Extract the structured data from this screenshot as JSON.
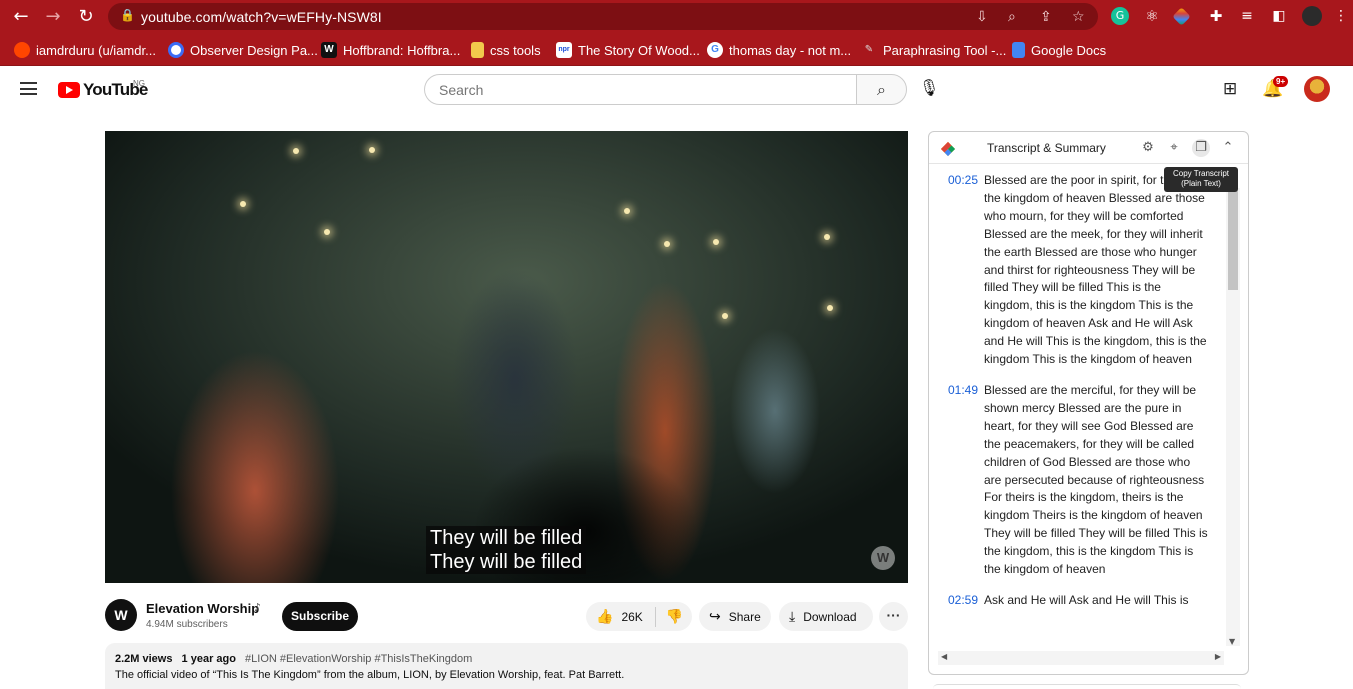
{
  "browser": {
    "url": "youtube.com/watch?v=wEFHy-NSW8I",
    "bookmarks": [
      {
        "label": "iamdrduru (u/iamdr...",
        "icon": "reddit-icon",
        "color": "#ff4500"
      },
      {
        "label": "Observer Design Pa...",
        "icon": "observer-icon",
        "color": "#3b6cf6"
      },
      {
        "label": "Hoffbrand: Hoffbra...",
        "icon": "w-icon",
        "color": "#111111"
      },
      {
        "label": "css tools",
        "icon": "folder-icon",
        "color": "#f2c94c"
      },
      {
        "label": "The Story Of Wood...",
        "icon": "npr-icon",
        "color": "#1d4ed8"
      },
      {
        "label": "thomas day - not m...",
        "icon": "google-icon",
        "color": "#ffffff"
      },
      {
        "label": "Paraphrasing Tool -...",
        "icon": "quill-icon",
        "color": "#9aa7b2"
      },
      {
        "label": "Google Docs",
        "icon": "docs-icon",
        "color": "#4285f4"
      }
    ]
  },
  "header": {
    "logo_text": "YouTube",
    "country": "NG",
    "search_placeholder": "Search",
    "notification_count": "9+"
  },
  "video": {
    "caption_line1": "They will be filled",
    "caption_line2": "They will be filled"
  },
  "channel": {
    "name": "Elevation Worship",
    "note_icon": "music-note-icon",
    "subscribers": "4.94M subscribers",
    "subscribe_label": "Subscribe",
    "likes": "26K",
    "share_label": "Share",
    "download_label": "Download"
  },
  "description": {
    "views": "2.2M views",
    "age": "1 year ago",
    "tags": "#LION #ElevationWorship #ThisIsTheKingdom",
    "text": "The official video of “This Is The Kingdom” from the album, LION, by Elevation Worship, feat. Pat Barrett."
  },
  "transcript": {
    "title": "Transcript & Summary",
    "tooltip_line1": "Copy Transcript",
    "tooltip_line2": "(Plain Text)",
    "entries": [
      {
        "time": "00:25",
        "text": "Blessed are the poor in spirit, for theirs is the kingdom of heaven Blessed are those who mourn, for they will be comforted Blessed are the meek, for they will inherit the earth Blessed are those who hunger and thirst for righteousness They will be filled They will be filled This is the kingdom, this is the kingdom This is the kingdom of heaven Ask and He will Ask and He will This is the kingdom, this is the kingdom This is the kingdom of heaven"
      },
      {
        "time": "01:49",
        "text": "Blessed are the merciful, for they will be shown mercy Blessed are the pure in heart, for they will see God Blessed are the peacemakers, for they will be called children of God Blessed are those who are persecuted because of righteousness For theirs is the kingdom, theirs is the kingdom Theirs is the kingdom of heaven They will be filled They will be filled This is the kingdom, this is the kingdom This is the kingdom of heaven"
      },
      {
        "time": "02:59",
        "text": "Ask and He will Ask and He will This is"
      }
    ]
  }
}
